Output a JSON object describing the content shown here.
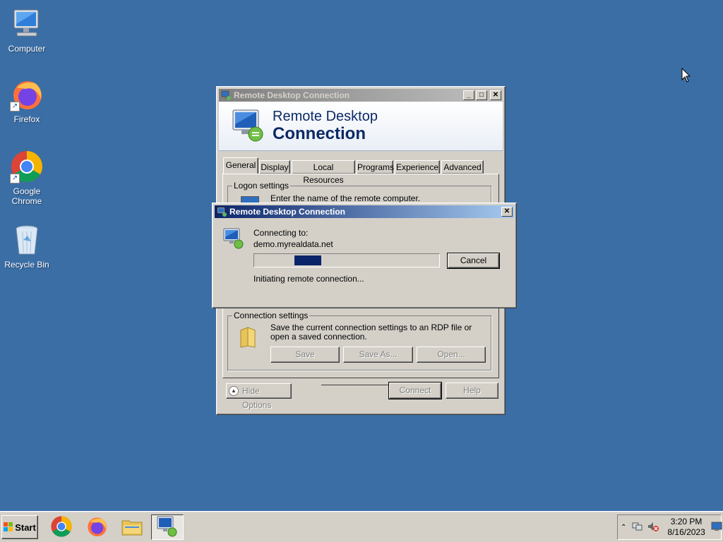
{
  "desktop": {
    "icons": [
      {
        "label": "Computer"
      },
      {
        "label": "Firefox"
      },
      {
        "label": "Google Chrome"
      },
      {
        "label": "Recycle Bin"
      }
    ]
  },
  "rdc_window": {
    "title": "Remote Desktop Connection",
    "banner_line1": "Remote Desktop",
    "banner_line2": "Connection",
    "tabs": [
      "General",
      "Display",
      "Local Resources",
      "Programs",
      "Experience",
      "Advanced"
    ],
    "logon_settings_label": "Logon settings",
    "logon_text": "Enter the name of the remote computer.",
    "connection_settings_label": "Connection settings",
    "connection_settings_text": "Save the current connection settings to an RDP file or open a saved connection.",
    "save_label": "Save",
    "save_as_label": "Save As...",
    "open_label": "Open...",
    "hide_options_label": "Hide Options",
    "connect_label": "Connect",
    "help_label": "Help"
  },
  "progress_dialog": {
    "title": "Remote Desktop Connection",
    "connecting_to_label": "Connecting to:",
    "host": "demo.myrealdata.net",
    "progress_position": 0.25,
    "cancel_label": "Cancel",
    "status_text": "Initiating remote connection..."
  },
  "taskbar": {
    "start_label": "Start",
    "apps": [
      "chrome-icon",
      "firefox-icon",
      "file-explorer-icon",
      "remote-desktop-icon"
    ],
    "clock_time": "3:20 PM",
    "clock_date": "8/16/2023"
  },
  "colors": {
    "desktop": "#3a6ea5",
    "titlebar_active": "#0a246a",
    "progress_block": "#0a246a"
  }
}
